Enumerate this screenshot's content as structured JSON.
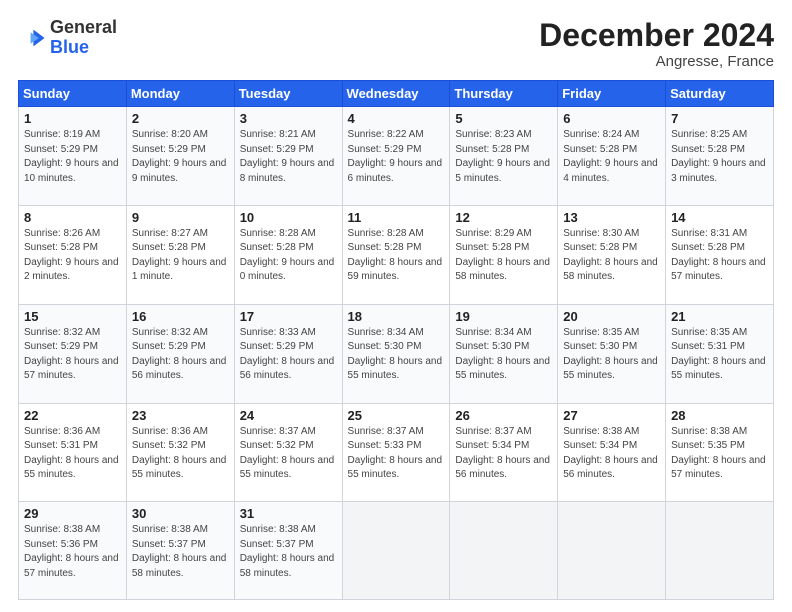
{
  "header": {
    "logo_general": "General",
    "logo_blue": "Blue",
    "month": "December 2024",
    "location": "Angresse, France"
  },
  "days_of_week": [
    "Sunday",
    "Monday",
    "Tuesday",
    "Wednesday",
    "Thursday",
    "Friday",
    "Saturday"
  ],
  "weeks": [
    [
      {
        "day": 1,
        "rise": "8:19 AM",
        "set": "5:29 PM",
        "detail": "9 hours and 10 minutes."
      },
      {
        "day": 2,
        "rise": "8:20 AM",
        "set": "5:29 PM",
        "detail": "9 hours and 9 minutes."
      },
      {
        "day": 3,
        "rise": "8:21 AM",
        "set": "5:29 PM",
        "detail": "9 hours and 8 minutes."
      },
      {
        "day": 4,
        "rise": "8:22 AM",
        "set": "5:29 PM",
        "detail": "9 hours and 6 minutes."
      },
      {
        "day": 5,
        "rise": "8:23 AM",
        "set": "5:28 PM",
        "detail": "9 hours and 5 minutes."
      },
      {
        "day": 6,
        "rise": "8:24 AM",
        "set": "5:28 PM",
        "detail": "9 hours and 4 minutes."
      },
      {
        "day": 7,
        "rise": "8:25 AM",
        "set": "5:28 PM",
        "detail": "9 hours and 3 minutes."
      }
    ],
    [
      {
        "day": 8,
        "rise": "8:26 AM",
        "set": "5:28 PM",
        "detail": "9 hours and 2 minutes."
      },
      {
        "day": 9,
        "rise": "8:27 AM",
        "set": "5:28 PM",
        "detail": "9 hours and 1 minute."
      },
      {
        "day": 10,
        "rise": "8:28 AM",
        "set": "5:28 PM",
        "detail": "9 hours and 0 minutes."
      },
      {
        "day": 11,
        "rise": "8:28 AM",
        "set": "5:28 PM",
        "detail": "8 hours and 59 minutes."
      },
      {
        "day": 12,
        "rise": "8:29 AM",
        "set": "5:28 PM",
        "detail": "8 hours and 58 minutes."
      },
      {
        "day": 13,
        "rise": "8:30 AM",
        "set": "5:28 PM",
        "detail": "8 hours and 58 minutes."
      },
      {
        "day": 14,
        "rise": "8:31 AM",
        "set": "5:28 PM",
        "detail": "8 hours and 57 minutes."
      }
    ],
    [
      {
        "day": 15,
        "rise": "8:32 AM",
        "set": "5:29 PM",
        "detail": "8 hours and 57 minutes."
      },
      {
        "day": 16,
        "rise": "8:32 AM",
        "set": "5:29 PM",
        "detail": "8 hours and 56 minutes."
      },
      {
        "day": 17,
        "rise": "8:33 AM",
        "set": "5:29 PM",
        "detail": "8 hours and 56 minutes."
      },
      {
        "day": 18,
        "rise": "8:34 AM",
        "set": "5:30 PM",
        "detail": "8 hours and 55 minutes."
      },
      {
        "day": 19,
        "rise": "8:34 AM",
        "set": "5:30 PM",
        "detail": "8 hours and 55 minutes."
      },
      {
        "day": 20,
        "rise": "8:35 AM",
        "set": "5:30 PM",
        "detail": "8 hours and 55 minutes."
      },
      {
        "day": 21,
        "rise": "8:35 AM",
        "set": "5:31 PM",
        "detail": "8 hours and 55 minutes."
      }
    ],
    [
      {
        "day": 22,
        "rise": "8:36 AM",
        "set": "5:31 PM",
        "detail": "8 hours and 55 minutes."
      },
      {
        "day": 23,
        "rise": "8:36 AM",
        "set": "5:32 PM",
        "detail": "8 hours and 55 minutes."
      },
      {
        "day": 24,
        "rise": "8:37 AM",
        "set": "5:32 PM",
        "detail": "8 hours and 55 minutes."
      },
      {
        "day": 25,
        "rise": "8:37 AM",
        "set": "5:33 PM",
        "detail": "8 hours and 55 minutes."
      },
      {
        "day": 26,
        "rise": "8:37 AM",
        "set": "5:34 PM",
        "detail": "8 hours and 56 minutes."
      },
      {
        "day": 27,
        "rise": "8:38 AM",
        "set": "5:34 PM",
        "detail": "8 hours and 56 minutes."
      },
      {
        "day": 28,
        "rise": "8:38 AM",
        "set": "5:35 PM",
        "detail": "8 hours and 57 minutes."
      }
    ],
    [
      {
        "day": 29,
        "rise": "8:38 AM",
        "set": "5:36 PM",
        "detail": "8 hours and 57 minutes."
      },
      {
        "day": 30,
        "rise": "8:38 AM",
        "set": "5:37 PM",
        "detail": "8 hours and 58 minutes."
      },
      {
        "day": 31,
        "rise": "8:38 AM",
        "set": "5:37 PM",
        "detail": "8 hours and 58 minutes."
      },
      null,
      null,
      null,
      null
    ]
  ]
}
